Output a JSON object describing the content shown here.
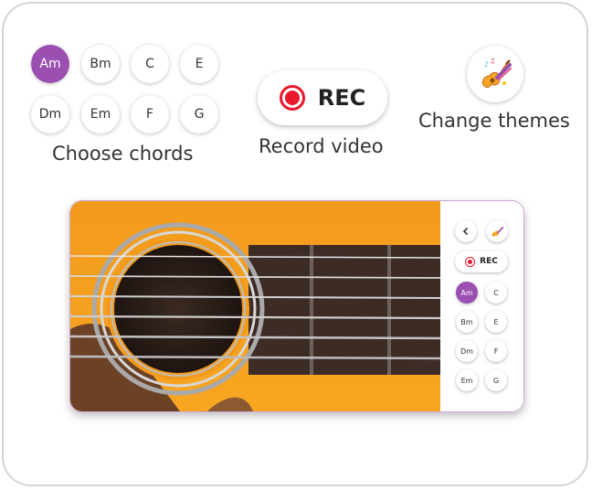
{
  "chords": {
    "row1": [
      "Am",
      "Bm",
      "C",
      "E"
    ],
    "row2": [
      "Dm",
      "Em",
      "F",
      "G"
    ],
    "active": "Am",
    "caption": "Choose chords"
  },
  "record": {
    "label": "REC",
    "caption": "Record video"
  },
  "themes": {
    "caption": "Change themes",
    "icon": "guitar-palette-icon"
  },
  "preview": {
    "back_icon": "chevron-left-icon",
    "theme_icon": "guitar-palette-icon",
    "rec_label": "REC",
    "chord_grid": [
      [
        "Am",
        "C"
      ],
      [
        "Bm",
        "E"
      ],
      [
        "Dm",
        "F"
      ],
      [
        "Em",
        "G"
      ]
    ],
    "active": "Am"
  },
  "colors": {
    "accent": "#9b4fb0",
    "record_red": "#e8192c",
    "guitar_orange": "#f7a21b"
  }
}
